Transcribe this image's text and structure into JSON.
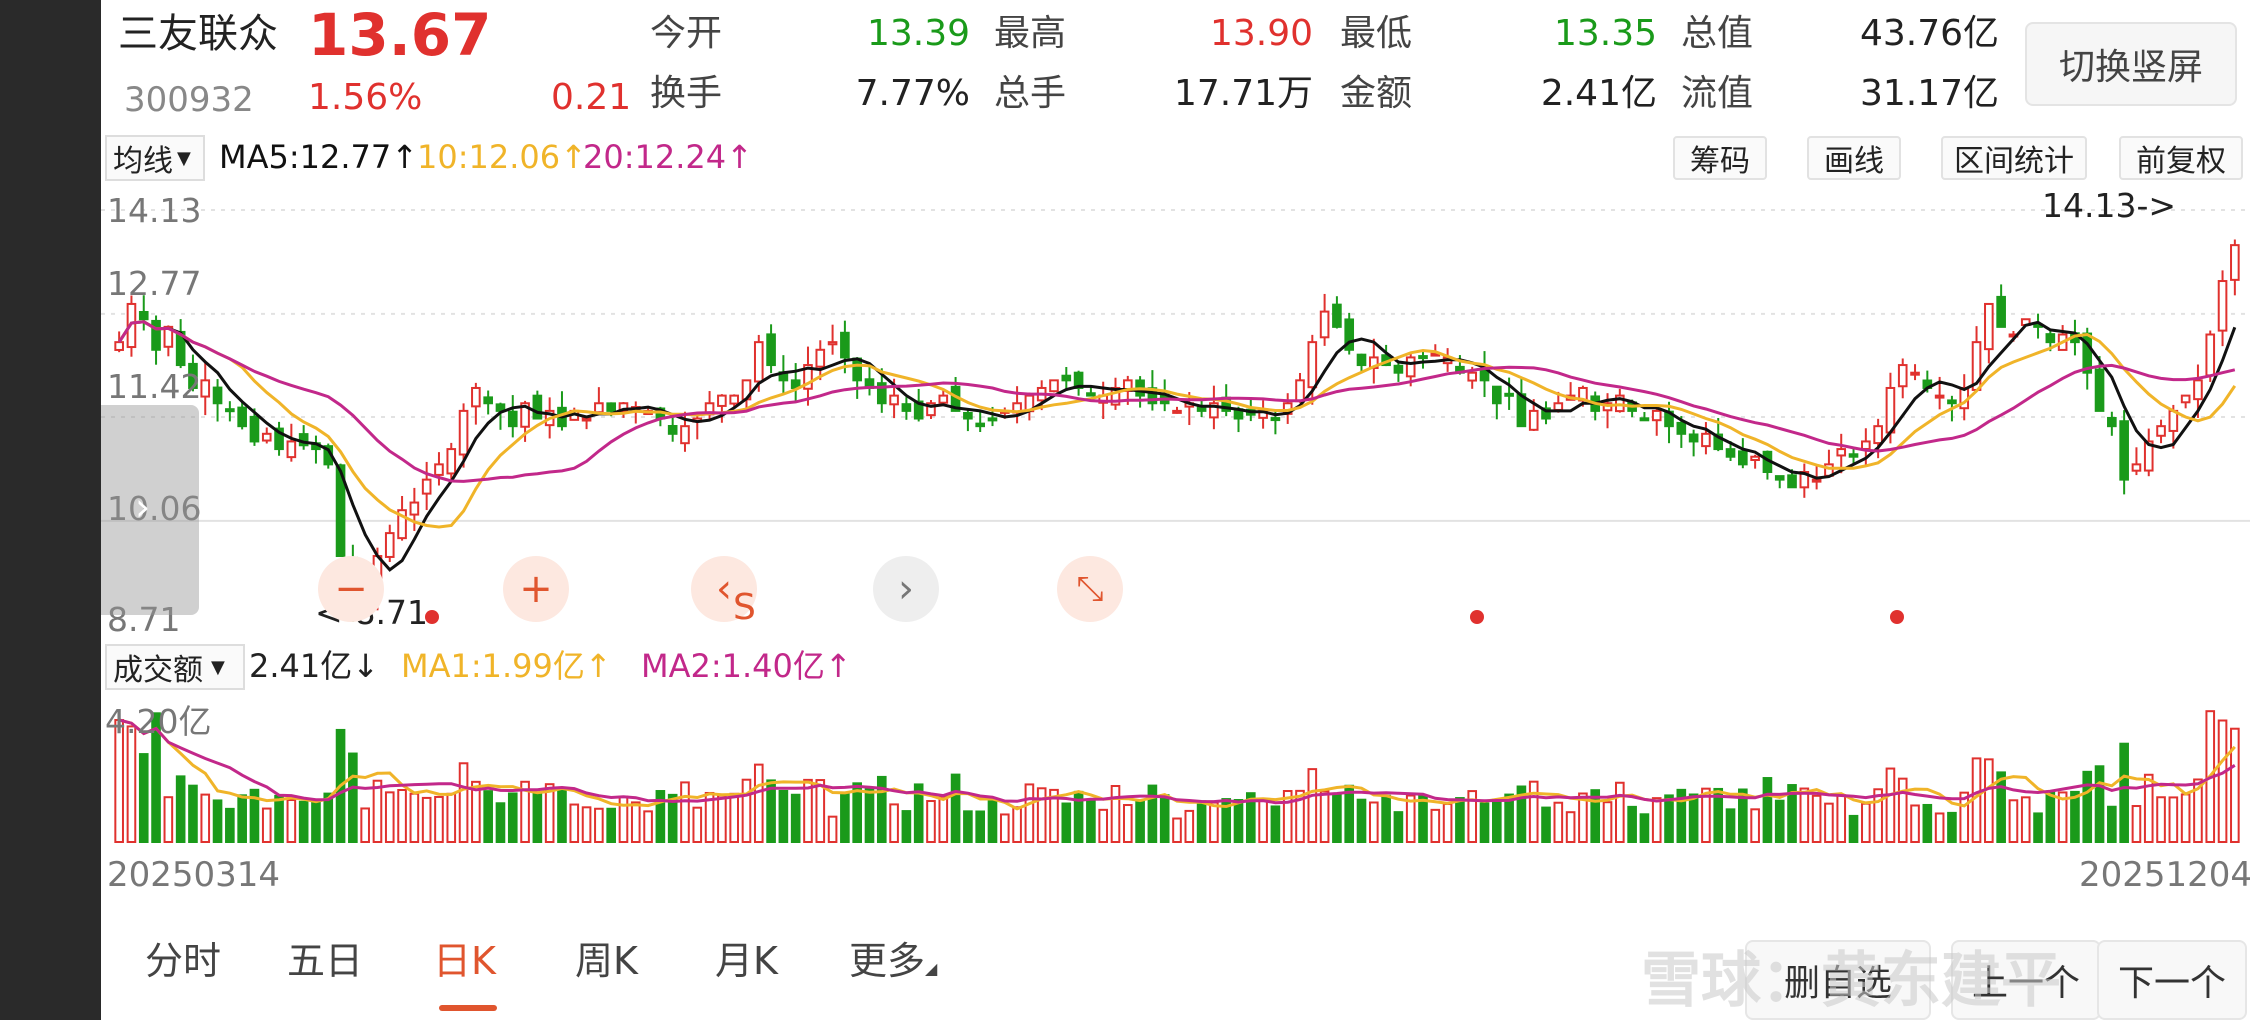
{
  "header": {
    "name": "三友联众",
    "price": "13.67",
    "code": "300932",
    "change_pct": "1.56%",
    "change": "0.21",
    "quotes_row1": [
      {
        "label": "今开",
        "value": "13.39",
        "color": "green"
      },
      {
        "label": "最高",
        "value": "13.90",
        "color": "red"
      },
      {
        "label": "最低",
        "value": "13.35",
        "color": "green"
      },
      {
        "label": "总值",
        "value": "43.76亿",
        "color": "dark"
      }
    ],
    "quotes_row2": [
      {
        "label": "换手",
        "value": "7.77%",
        "color": "dark"
      },
      {
        "label": "总手",
        "value": "17.71万",
        "color": "dark"
      },
      {
        "label": "金额",
        "value": "2.41亿",
        "color": "dark"
      },
      {
        "label": "流值",
        "value": "31.17亿",
        "color": "dark"
      }
    ],
    "switch_button": "切换竖屏"
  },
  "ma_bar": {
    "selector": "均线",
    "ma5": "MA5:12.77↑",
    "ma10": "10:12.06↑",
    "ma20": "20:12.24↑",
    "tools": [
      "筹码",
      "画线",
      "区间统计",
      "前复权"
    ]
  },
  "vol_bar": {
    "selector": "成交额",
    "current": "2.41亿↓",
    "ma1": "MA1:1.99亿↑",
    "ma2": "MA2:1.40亿↑"
  },
  "price_axis": [
    "14.13",
    "12.77",
    "11.42",
    "10.06",
    "8.71"
  ],
  "vol_axis": "4.20亿",
  "annotations": {
    "high": "14.13->",
    "low": "<-8.71",
    "sell_marker": "S"
  },
  "dates": {
    "start": "20250314",
    "end": "20251204"
  },
  "controls": [
    "minus-icon",
    "plus-icon",
    "chevron-left-icon",
    "chevron-right-icon",
    "shrink-icon"
  ],
  "tabs": [
    "分时",
    "五日",
    "日K",
    "周K",
    "月K",
    "更多"
  ],
  "active_tab": "日K",
  "nav_buttons": [
    "删自选",
    "上一个",
    "下一个"
  ],
  "watermark": "雪球：黄东建平",
  "colors": {
    "up": "#e0312e",
    "down": "#1a9a1a",
    "ma5": "#111111",
    "ma10": "#f0b429",
    "ma20": "#c2288a",
    "accent": "#e0552e"
  },
  "chart_data": {
    "type": "candlestick",
    "ylim": [
      8.71,
      14.13
    ],
    "price_closes": [
      12.4,
      12.9,
      12.7,
      12.3,
      12.6,
      12.1,
      11.8,
      11.9,
      11.6,
      11.5,
      11.3,
      11.1,
      11.2,
      11.0,
      11.1,
      11.05,
      11.0,
      10.8,
      9.6,
      8.9,
      9.1,
      9.6,
      9.9,
      10.2,
      10.3,
      10.6,
      10.8,
      11.0,
      11.5,
      11.8,
      11.6,
      11.5,
      11.3,
      11.6,
      11.4,
      11.5,
      11.3,
      11.5,
      11.4,
      11.6,
      11.5,
      11.6,
      11.55,
      11.5,
      11.4,
      11.2,
      11.3,
      11.4,
      11.6,
      11.7,
      11.7,
      11.9,
      12.4,
      12.1,
      11.9,
      11.8,
      12.1,
      12.3,
      12.4,
      12.2,
      11.9,
      11.8,
      11.6,
      11.7,
      11.5,
      11.4,
      11.6,
      11.7,
      11.5,
      11.4,
      11.3,
      11.4,
      11.5,
      11.6,
      11.7,
      11.8,
      11.9,
      11.9,
      11.8,
      11.7,
      11.7,
      11.8,
      11.9,
      11.7,
      11.6,
      11.6,
      11.5,
      11.6,
      11.5,
      11.6,
      11.5,
      11.4,
      11.45,
      11.5,
      11.4,
      11.6,
      11.9,
      12.4,
      12.8,
      12.6,
      12.3,
      12.1,
      12.2,
      12.1,
      12.0,
      12.2,
      12.2,
      12.25,
      12.2,
      12.0,
      12.0,
      11.9,
      11.6,
      11.7,
      11.3,
      11.5,
      11.4,
      11.6,
      11.7,
      11.8,
      11.5,
      11.6,
      11.7,
      11.5,
      11.4,
      11.5,
      11.3,
      11.2,
      11.1,
      11.2,
      11.0,
      10.9,
      10.8,
      10.9,
      10.7,
      10.6,
      10.5,
      10.7,
      10.6,
      10.8,
      11.0,
      10.9,
      11.1,
      11.3,
      11.8,
      12.1,
      12.0,
      11.8,
      11.7,
      11.6,
      11.8,
      12.4,
      12.9,
      12.6,
      12.5,
      12.7,
      12.6,
      12.4,
      12.5,
      12.4,
      12.0,
      11.5,
      11.3,
      10.6,
      10.8,
      11.1,
      11.3,
      11.5,
      11.7,
      11.9,
      12.5,
      13.2,
      13.67
    ],
    "volume_note": "bars in 亿, axis top 4.20亿"
  }
}
